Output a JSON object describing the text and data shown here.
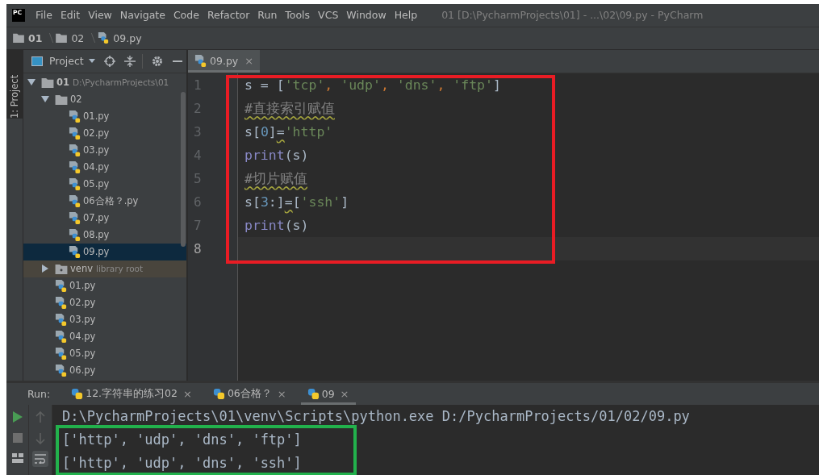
{
  "window": {
    "title": "01 [D:\\PycharmProjects\\01] - ...\\02\\09.py - PyCharm"
  },
  "app_logo": "PC",
  "menu": [
    "File",
    "Edit",
    "View",
    "Navigate",
    "Code",
    "Refactor",
    "Run",
    "Tools",
    "VCS",
    "Window",
    "Help"
  ],
  "breadcrumbs": [
    {
      "label": "01",
      "kind": "folder"
    },
    {
      "label": "02",
      "kind": "folder"
    },
    {
      "label": "09.py",
      "kind": "file"
    }
  ],
  "tool_strip": {
    "label": "1: Project"
  },
  "project_panel": {
    "title": "Project",
    "tree": [
      {
        "label": "01",
        "hint": "D:\\PycharmProjects\\01",
        "kind": "folder",
        "expanded": true,
        "selected": false,
        "children": [
          {
            "label": "02",
            "kind": "folder",
            "expanded": true,
            "selected": false,
            "children": [
              {
                "label": "01.py",
                "kind": "file",
                "selected": false
              },
              {
                "label": "02.py",
                "kind": "file",
                "selected": false
              },
              {
                "label": "03.py",
                "kind": "file",
                "selected": false
              },
              {
                "label": "04.py",
                "kind": "file",
                "selected": false
              },
              {
                "label": "05.py",
                "kind": "file",
                "selected": false
              },
              {
                "label": "06合格？.py",
                "kind": "file",
                "selected": false
              },
              {
                "label": "07.py",
                "kind": "file",
                "selected": false
              },
              {
                "label": "08.py",
                "kind": "file",
                "selected": false
              },
              {
                "label": "09.py",
                "kind": "file",
                "selected": true
              }
            ]
          },
          {
            "label": "venv",
            "hint": "library root",
            "kind": "library",
            "expanded": false,
            "selected": false
          },
          {
            "label": "01.py",
            "kind": "file",
            "selected": false
          },
          {
            "label": "02.py",
            "kind": "file",
            "selected": false
          },
          {
            "label": "03.py",
            "kind": "file",
            "selected": false
          },
          {
            "label": "04.py",
            "kind": "file",
            "selected": false
          },
          {
            "label": "05.py",
            "kind": "file",
            "selected": false
          },
          {
            "label": "06.py",
            "kind": "file",
            "selected": false
          }
        ]
      }
    ]
  },
  "editor": {
    "tabs": [
      {
        "label": "09.py",
        "close": "×",
        "selected": true
      }
    ],
    "lines": [
      {
        "number": "1",
        "current": false,
        "tokens": [
          {
            "kind": "plain",
            "text": "s = ["
          },
          {
            "kind": "string",
            "text": "'tcp'"
          },
          {
            "kind": "comma",
            "text": ", "
          },
          {
            "kind": "string",
            "text": "'udp'"
          },
          {
            "kind": "comma",
            "text": ", "
          },
          {
            "kind": "string",
            "text": "'dns'"
          },
          {
            "kind": "comma",
            "text": ", "
          },
          {
            "kind": "string",
            "text": "'ftp'"
          },
          {
            "kind": "plain",
            "text": "]"
          }
        ]
      },
      {
        "number": "2",
        "current": false,
        "tokens": [
          {
            "kind": "comment",
            "text": "#直接索引赋值"
          }
        ]
      },
      {
        "number": "3",
        "current": false,
        "tokens": [
          {
            "kind": "plain",
            "text": "s["
          },
          {
            "kind": "number",
            "text": "0"
          },
          {
            "kind": "plain",
            "text": "]"
          },
          {
            "kind": "warn",
            "text": "="
          },
          {
            "kind": "string",
            "text": "'http'"
          }
        ]
      },
      {
        "number": "4",
        "current": false,
        "tokens": [
          {
            "kind": "builtin",
            "text": "print"
          },
          {
            "kind": "plain",
            "text": "(s)"
          }
        ]
      },
      {
        "number": "5",
        "current": false,
        "tokens": [
          {
            "kind": "comment",
            "text": "#切片赋值"
          }
        ]
      },
      {
        "number": "6",
        "current": false,
        "tokens": [
          {
            "kind": "plain",
            "text": "s["
          },
          {
            "kind": "number",
            "text": "3"
          },
          {
            "kind": "plain",
            "text": ":]"
          },
          {
            "kind": "warn",
            "text": "="
          },
          {
            "kind": "plain",
            "text": "["
          },
          {
            "kind": "string",
            "text": "'ssh'"
          },
          {
            "kind": "plain",
            "text": "]"
          }
        ]
      },
      {
        "number": "7",
        "current": false,
        "tokens": [
          {
            "kind": "builtin",
            "text": "print"
          },
          {
            "kind": "plain",
            "text": "(s)"
          }
        ]
      },
      {
        "number": "8",
        "current": true
      }
    ]
  },
  "run": {
    "label": "Run:",
    "tabs": [
      {
        "label": "12.字符串的练习02",
        "close": "×",
        "selected": false
      },
      {
        "label": "06合格？",
        "close": "×",
        "selected": false
      },
      {
        "label": "09",
        "close": "×",
        "selected": true
      }
    ],
    "command": "D:\\PycharmProjects\\01\\venv\\Scripts\\python.exe D:/PycharmProjects/01/02/09.py",
    "output": [
      "['http', 'udp', 'dns', 'ftp']",
      "['http', 'udp', 'dns', 'ssh']"
    ]
  }
}
